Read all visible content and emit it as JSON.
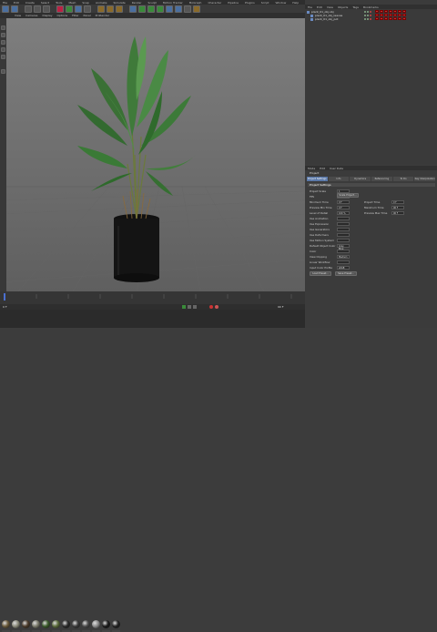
{
  "menu": [
    "File",
    "Edit",
    "Create",
    "Select",
    "Tools",
    "Mesh",
    "Snap",
    "Animate",
    "Simulate",
    "Render",
    "Sculpt",
    "Motion Tracker",
    "MoGraph",
    "Character",
    "Pipeline",
    "Plugins",
    "Script",
    "Window",
    "Help"
  ],
  "viewport_menu": [
    "View",
    "Cameras",
    "Display",
    "Options",
    "Filter",
    "Panel",
    "ProRender"
  ],
  "object_manager": {
    "tabs": [
      "File",
      "Edit",
      "View",
      "Objects",
      "Tags",
      "Bookmarks"
    ],
    "objects": [
      "plant_01_obj.obj",
      "plant_01_obj_leaves",
      "plant_01_obj_pot"
    ]
  },
  "attribute_manager": {
    "tabs_header": [
      "Mode",
      "Edit",
      "User Data"
    ],
    "object_label": "Project",
    "tabs": [
      "Project Settings",
      "Info",
      "Dynamics",
      "Referencing",
      "To Do",
      "Key Interpolation"
    ],
    "section": "Project Settings",
    "rows": [
      {
        "label": "Project Scale",
        "value": "1"
      },
      {
        "label": "FPS",
        "value": "30"
      },
      {
        "label": "Minimum Time",
        "value": "0 F"
      },
      {
        "label": "Preview Min Time",
        "value": "0 F"
      },
      {
        "label": "Level of Detail",
        "value": "100 %"
      },
      {
        "label": "Use Animation",
        "value": ""
      },
      {
        "label": "Use Expression",
        "value": ""
      },
      {
        "label": "Use Generators",
        "value": ""
      },
      {
        "label": "Use Deformers",
        "value": ""
      },
      {
        "label": "Use Motion System",
        "value": ""
      },
      {
        "label": "Default Object Color",
        "value": "Gray Blue"
      },
      {
        "label": "Color",
        "value": ""
      },
      {
        "label": "View Clipping",
        "value": "Medium"
      },
      {
        "label": "Linear Workflow",
        "value": ""
      },
      {
        "label": "Input Color Profile",
        "value": "sRGB"
      }
    ],
    "right_rows": [
      {
        "label": "Project Time",
        "value": "0 F"
      },
      {
        "label": "Maximum Time",
        "value": "90 F"
      },
      {
        "label": "Preview Max Time",
        "value": "90 F"
      }
    ],
    "buttons": [
      "Scale Project...",
      "Load Preset...",
      "Save Preset..."
    ]
  },
  "materials": [
    {
      "color": "#6a5a3a"
    },
    {
      "color": "#8a8a7a"
    },
    {
      "color": "#4a3a2a"
    },
    {
      "color": "#7a7a6a"
    },
    {
      "color": "#3a5a2a"
    },
    {
      "color": "#5a6a3a"
    },
    {
      "color": "#2a2a2a"
    },
    {
      "color": "#3a3a3a"
    },
    {
      "color": "#4a4a4a"
    },
    {
      "color": "#8a8a8a"
    },
    {
      "color": "#1a1a1a"
    },
    {
      "color": "#222222"
    }
  ],
  "timeline": {
    "frame": "0 F",
    "end": "90 F"
  }
}
